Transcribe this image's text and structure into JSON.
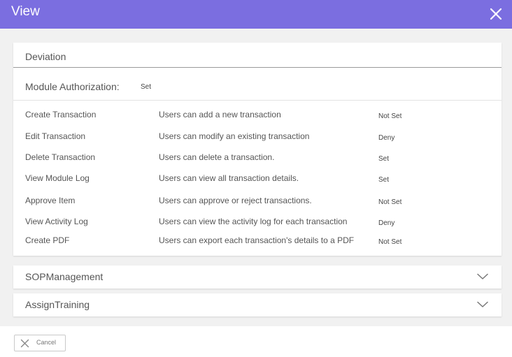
{
  "header": {
    "title": "View",
    "close_icon": "close-icon",
    "background_color": "#7b6ee0"
  },
  "section": {
    "title": "Deviation",
    "module_authorization_label": "Module Authorization:",
    "module_authorization_value": "Set"
  },
  "permissions": [
    {
      "name": "Create Transaction",
      "description": "Users can add a new transaction",
      "status": "Not Set"
    },
    {
      "name": "Edit Transaction",
      "description": "Users can modify an existing transaction",
      "status": "Deny"
    },
    {
      "name": "Delete Transaction",
      "description": "Users can delete a transaction.",
      "status": "Set"
    },
    {
      "name": "View Module Log",
      "description": "Users can view all transaction details.",
      "status": "Set"
    },
    {
      "name": "Approve Item",
      "description": "Users can approve or reject transactions.",
      "status": "Not Set"
    },
    {
      "name": "View Activity Log",
      "description": "Users can view the activity log for each transaction",
      "status": "Deny"
    },
    {
      "name": "Create PDF",
      "description": "Users can export each transaction's details to a PDF",
      "status": "Not Set"
    }
  ],
  "accordions": [
    {
      "title": "SOPManagement",
      "icon": "chevron-down-icon"
    },
    {
      "title": "AssignTraining",
      "icon": "chevron-down-icon"
    }
  ],
  "footer": {
    "cancel_label": "Cancel",
    "cancel_icon": "close-icon"
  }
}
